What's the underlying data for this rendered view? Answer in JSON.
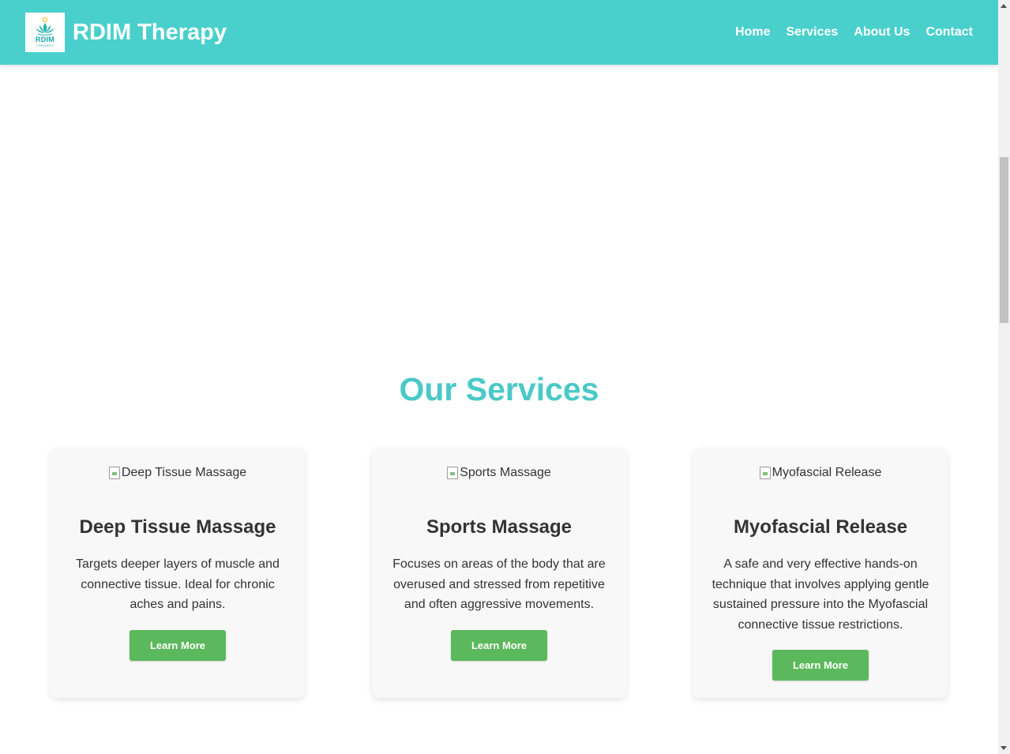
{
  "header": {
    "brand": "RDIM Therapy",
    "logo_text": "RDIM",
    "logo_sub": "THERAPY",
    "nav": [
      "Home",
      "Services",
      "About Us",
      "Contact"
    ]
  },
  "services": {
    "title": "Our Services",
    "cards": [
      {
        "image_alt": "Deep Tissue Massage",
        "title": "Deep Tissue Massage",
        "description": "Targets deeper layers of muscle and connective tissue. Ideal for chronic aches and pains.",
        "button": "Learn More"
      },
      {
        "image_alt": "Sports Massage",
        "title": "Sports Massage",
        "description": "Focuses on areas of the body that are overused and stressed from repetitive and often aggressive movements.",
        "button": "Learn More"
      },
      {
        "image_alt": "Myofascial Release",
        "title": "Myofascial Release",
        "description": "A safe and very effective hands-on technique that involves applying gentle sustained pressure into the Myofascial connective tissue restrictions.",
        "button": "Learn More"
      }
    ]
  },
  "colors": {
    "header_bg": "#4ad0cc",
    "title": "#4ac9c8",
    "button": "#5cb85c"
  }
}
